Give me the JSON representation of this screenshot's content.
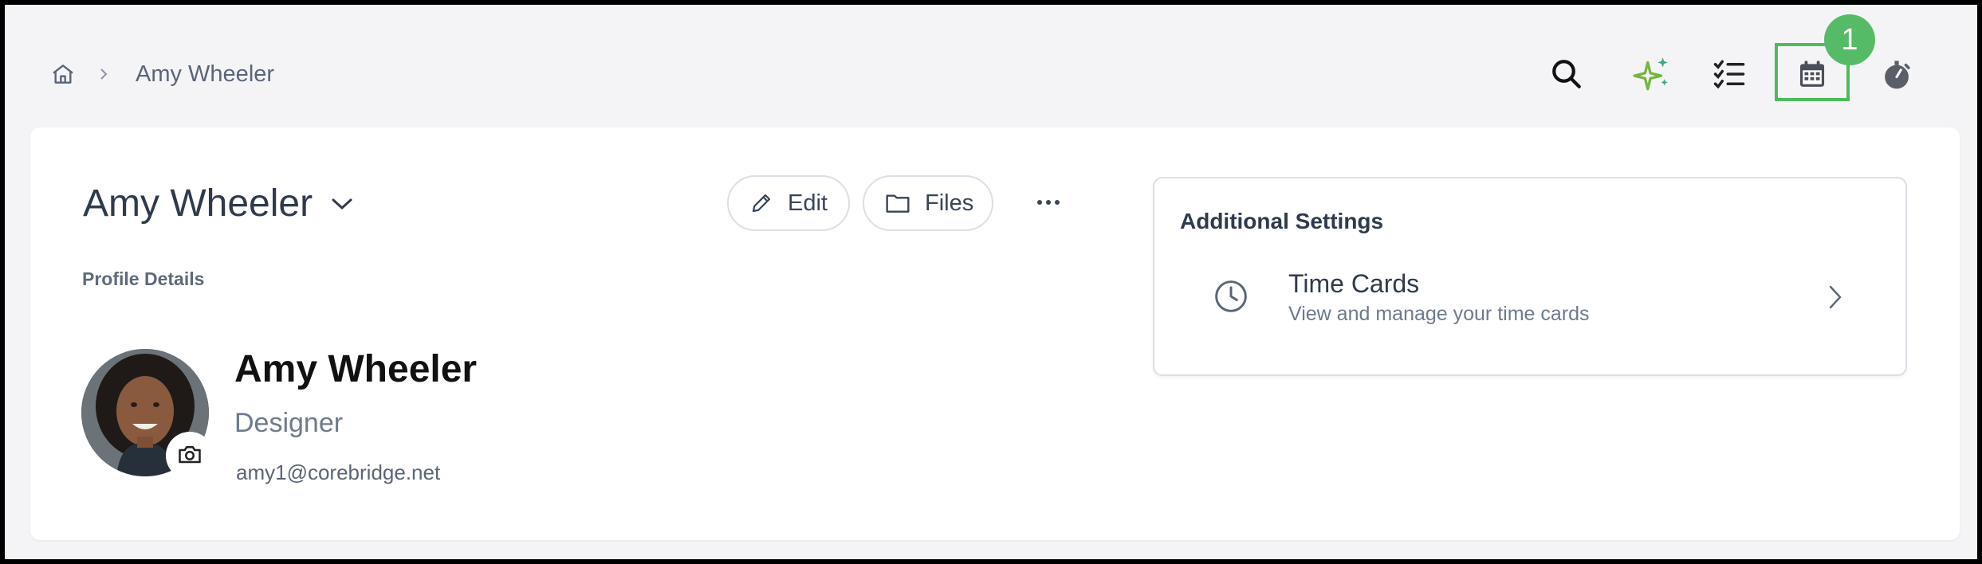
{
  "breadcrumb": {
    "current": "Amy Wheeler"
  },
  "toolbar": {
    "icons": [
      "search-icon",
      "sparkles-icon",
      "checklist-icon",
      "calendar-icon",
      "stopwatch-icon"
    ],
    "highlight_color": "#4cbb5c",
    "step_badge": "1"
  },
  "profile": {
    "heading": "Amy Wheeler",
    "edit_label": "Edit",
    "files_label": "Files",
    "section_label": "Profile Details",
    "name": "Amy Wheeler",
    "role": "Designer",
    "email": "amy1@corebridge.net"
  },
  "settings": {
    "title": "Additional Settings",
    "items": [
      {
        "title": "Time Cards",
        "subtitle": "View and manage your time cards",
        "icon": "clock-icon"
      }
    ]
  },
  "colors": {
    "background": "#f4f4f6",
    "card": "#ffffff",
    "text": "#2f3a4d",
    "accent_green": "#56bb66"
  }
}
